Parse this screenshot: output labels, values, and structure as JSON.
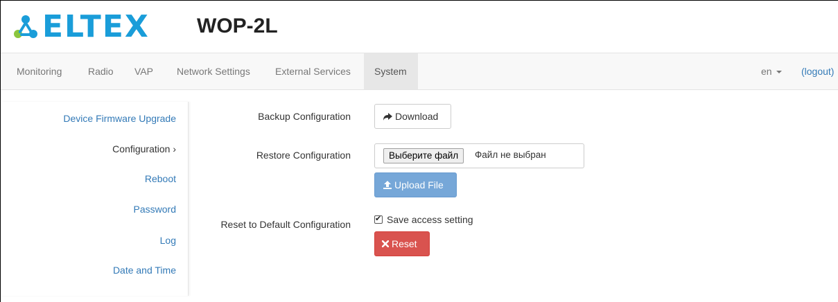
{
  "header": {
    "logo_text": "ELTEX",
    "model": "WOP-2L",
    "brand_colors": {
      "logo_blue": "#1a9dd9",
      "logo_green": "#8cc63e"
    }
  },
  "navbar": {
    "tabs": [
      {
        "label": "Monitoring"
      },
      {
        "label": "Radio"
      },
      {
        "label": "VAP"
      },
      {
        "label": "Network Settings"
      },
      {
        "label": "External Services"
      },
      {
        "label": "System",
        "active": true
      }
    ],
    "language": "en",
    "logout": "(logout)"
  },
  "sidebar": {
    "items": [
      {
        "label": "Device Firmware Upgrade"
      },
      {
        "label": "Configuration ›",
        "active": true
      },
      {
        "label": "Reboot"
      },
      {
        "label": "Password"
      },
      {
        "label": "Log"
      },
      {
        "label": "Date and Time"
      }
    ]
  },
  "main": {
    "backup": {
      "label": "Backup Configuration",
      "button": "Download",
      "icon": "share-arrow-icon"
    },
    "restore": {
      "label": "Restore Configuration",
      "choose_file": "Выберите файл",
      "no_file": "Файл не выбран",
      "upload_button": "Upload File",
      "upload_icon": "upload-icon"
    },
    "reset": {
      "label": "Reset to Default Configuration",
      "checkbox_label": "Save access setting",
      "checkbox_checked": true,
      "button": "Reset",
      "icon": "close-icon"
    }
  },
  "colors": {
    "link": "#337ab7",
    "primary": "#6fa3d6",
    "danger": "#d9534f"
  }
}
